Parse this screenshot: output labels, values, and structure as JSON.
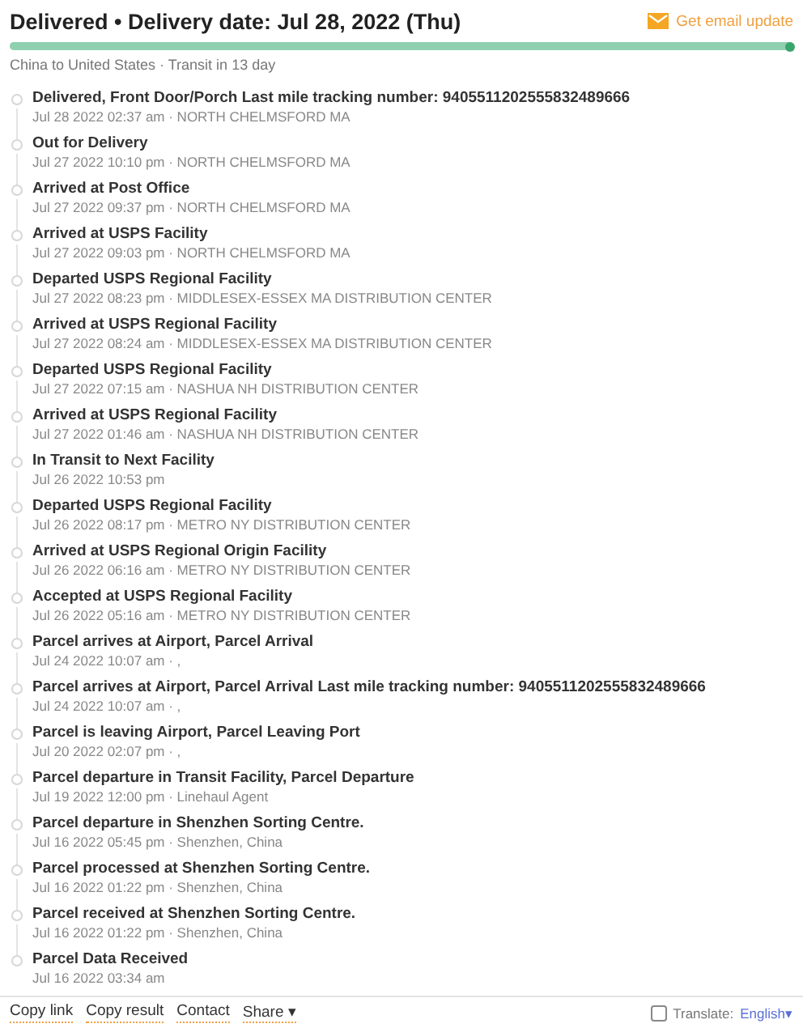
{
  "header": {
    "title": "Delivered • Delivery date: Jul 28, 2022 (Thu)",
    "email_link": "Get email update",
    "progress": {
      "level": 1
    },
    "route": "China to United States · Transit in 13 day"
  },
  "events": [
    {
      "title": "Delivered, Front Door/Porch Last mile tracking number: 9405511202555832489666",
      "detail": "Jul 28 2022 02:37 am · NORTH CHELMSFORD MA"
    },
    {
      "title": "Out for Delivery",
      "detail": "Jul 27 2022 10:10 pm · NORTH CHELMSFORD MA"
    },
    {
      "title": "Arrived at Post Office",
      "detail": "Jul 27 2022 09:37 pm · NORTH CHELMSFORD MA"
    },
    {
      "title": "Arrived at USPS Facility",
      "detail": "Jul 27 2022 09:03 pm · NORTH CHELMSFORD MA"
    },
    {
      "title": "Departed USPS Regional Facility",
      "detail": "Jul 27 2022 08:23 pm · MIDDLESEX-ESSEX MA DISTRIBUTION CENTER"
    },
    {
      "title": "Arrived at USPS Regional Facility",
      "detail": "Jul 27 2022 08:24 am · MIDDLESEX-ESSEX MA DISTRIBUTION CENTER"
    },
    {
      "title": "Departed USPS Regional Facility",
      "detail": "Jul 27 2022 07:15 am · NASHUA NH DISTRIBUTION CENTER"
    },
    {
      "title": "Arrived at USPS Regional Facility",
      "detail": "Jul 27 2022 01:46 am · NASHUA NH DISTRIBUTION CENTER"
    },
    {
      "title": "In Transit to Next Facility",
      "detail": "Jul 26 2022 10:53 pm"
    },
    {
      "title": "Departed USPS Regional Facility",
      "detail": "Jul 26 2022 08:17 pm · METRO NY DISTRIBUTION CENTER"
    },
    {
      "title": "Arrived at USPS Regional Origin Facility",
      "detail": "Jul 26 2022 06:16 am · METRO NY DISTRIBUTION CENTER"
    },
    {
      "title": "Accepted at USPS Regional Facility",
      "detail": "Jul 26 2022 05:16 am · METRO NY DISTRIBUTION CENTER"
    },
    {
      "title": "Parcel arrives at Airport, Parcel Arrival",
      "detail": "Jul 24 2022 10:07 am · ,"
    },
    {
      "title": "Parcel arrives at Airport, Parcel Arrival Last mile tracking number: 9405511202555832489666",
      "detail": "Jul 24 2022 10:07 am · ,"
    },
    {
      "title": "Parcel is leaving Airport, Parcel Leaving Port",
      "detail": "Jul 20 2022 02:07 pm · ,"
    },
    {
      "title": "Parcel departure in Transit Facility, Parcel Departure",
      "detail": "Jul 19 2022 12:00 pm · Linehaul Agent"
    },
    {
      "title": "Parcel departure in Shenzhen Sorting Centre.",
      "detail": "Jul 16 2022 05:45 pm · Shenzhen, China"
    },
    {
      "title": "Parcel processed at Shenzhen Sorting Centre.",
      "detail": "Jul 16 2022 01:22 pm · Shenzhen, China"
    },
    {
      "title": "Parcel received at Shenzhen Sorting Centre.",
      "detail": "Jul 16 2022 01:22 pm · Shenzhen, China"
    },
    {
      "title": "Parcel Data Received",
      "detail": "Jul 16 2022 03:34 am"
    }
  ],
  "footer": {
    "links": [
      "Copy link",
      "Copy result",
      "Contact"
    ],
    "share": "Share",
    "share_caret": "▾",
    "translate": {
      "checked": false,
      "label": "Translate:",
      "language": "English",
      "caret": "▾"
    }
  }
}
